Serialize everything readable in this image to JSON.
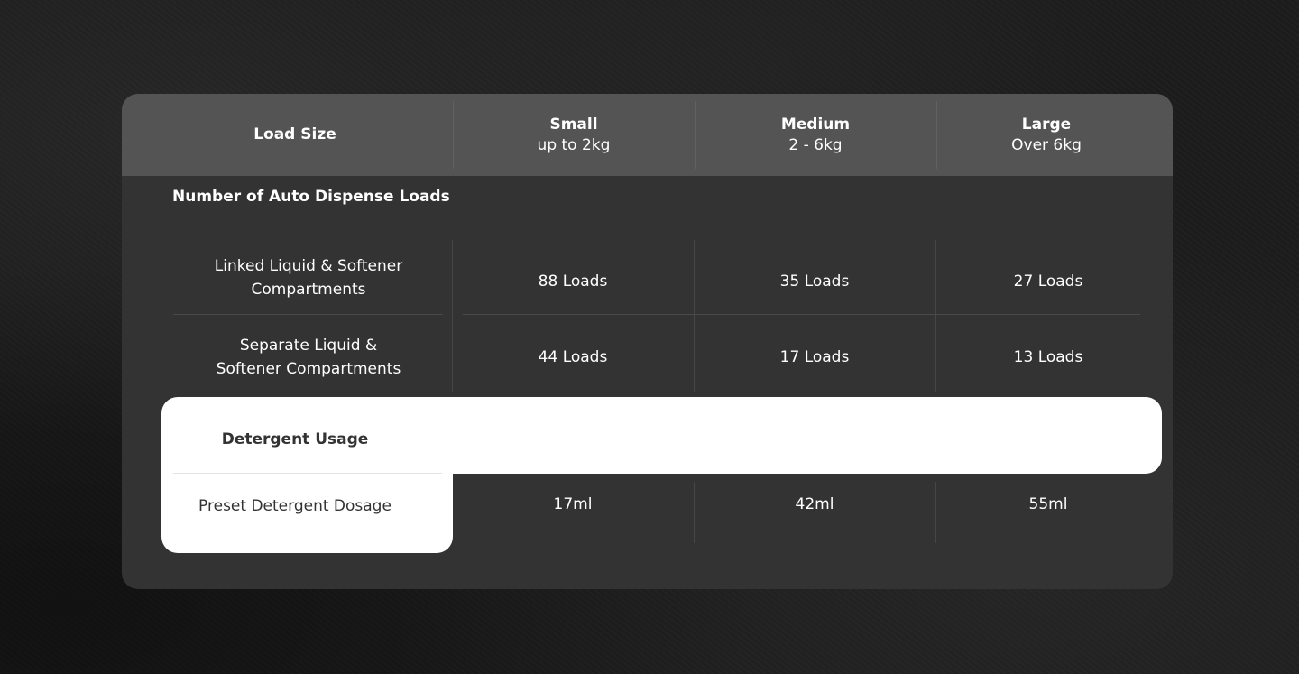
{
  "header": {
    "load_size": "Load Size",
    "columns": [
      {
        "name": "Small",
        "range": "up to 2kg"
      },
      {
        "name": "Medium",
        "range": "2 - 6kg"
      },
      {
        "name": "Large",
        "range": "Over 6kg"
      }
    ]
  },
  "auto_dispense": {
    "title": "Number of Auto Dispense Loads",
    "rows": [
      {
        "label_line1": "Linked Liquid & Softener",
        "label_line2": "Compartments",
        "values": [
          "88 Loads",
          "35 Loads",
          "27 Loads"
        ]
      },
      {
        "label_line1": "Separate Liquid &",
        "label_line2": "Softener Compartments",
        "values": [
          "44 Loads",
          "17 Loads",
          "13 Loads"
        ]
      }
    ]
  },
  "detergent": {
    "title": "Detergent Usage",
    "row": {
      "label": "Preset Detergent Dosage",
      "values": [
        "17ml",
        "42ml",
        "55ml"
      ]
    }
  }
}
